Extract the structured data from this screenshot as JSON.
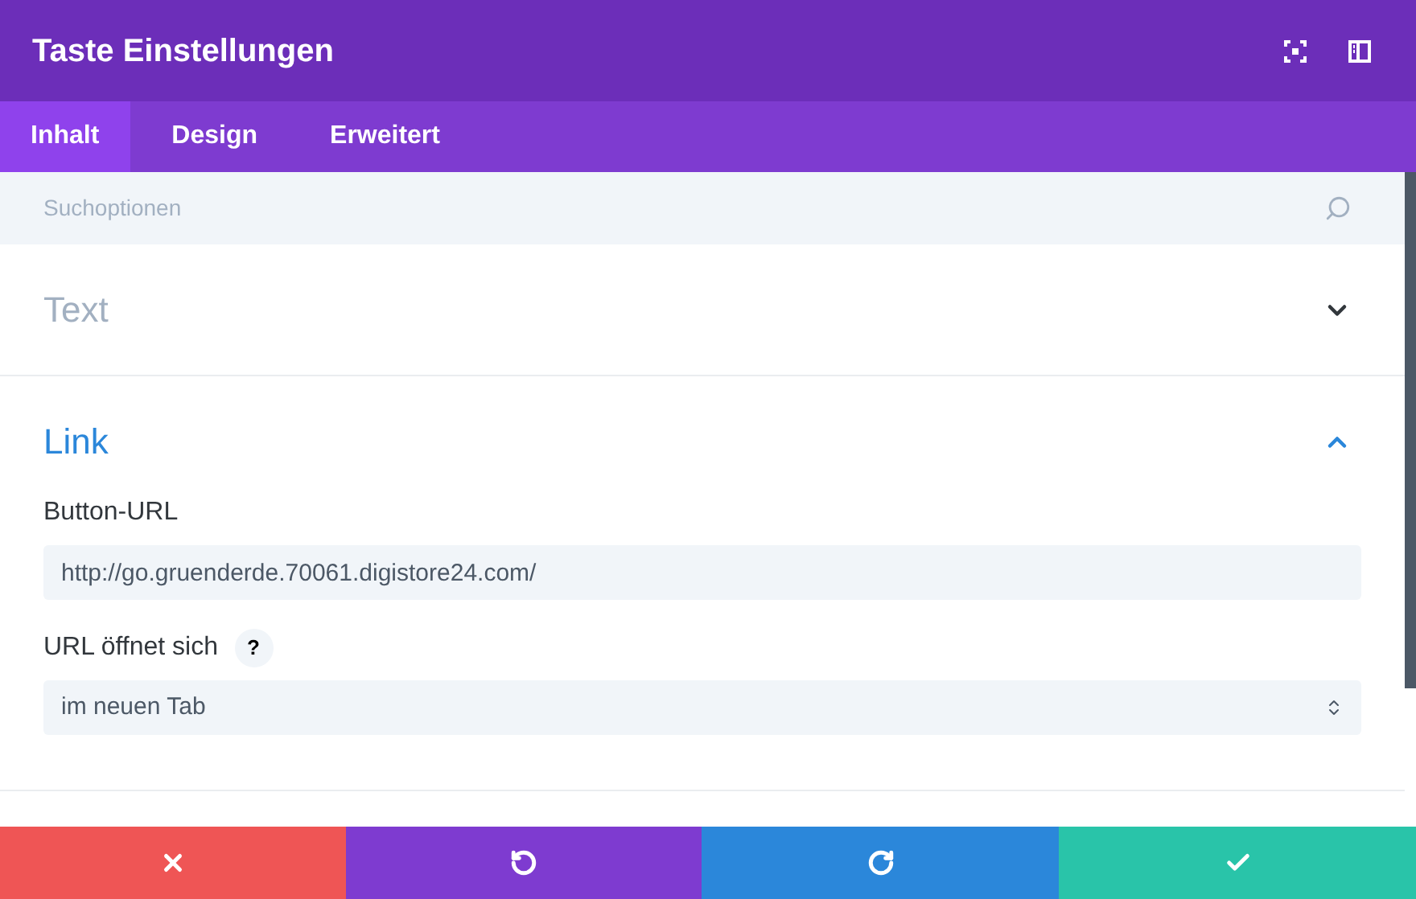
{
  "window": {
    "title": "Taste Einstellungen"
  },
  "tabs": [
    {
      "label": "Inhalt",
      "selected": true
    },
    {
      "label": "Design",
      "selected": false
    },
    {
      "label": "Erweitert",
      "selected": false
    }
  ],
  "search": {
    "placeholder": "Suchoptionen"
  },
  "sections": [
    {
      "title": "Text",
      "expanded": false
    },
    {
      "title": "Link",
      "expanded": true,
      "fields": [
        {
          "kind": "text",
          "label": "Button-URL",
          "value": "http://go.gruenderde.70061.digistore24.com/"
        },
        {
          "kind": "select",
          "label": "URL öffnet sich",
          "help": "?",
          "value": "im neuen Tab"
        }
      ]
    }
  ],
  "footer": [
    {
      "kind": "cancel"
    },
    {
      "kind": "undo"
    },
    {
      "kind": "redo"
    },
    {
      "kind": "save"
    }
  ]
}
